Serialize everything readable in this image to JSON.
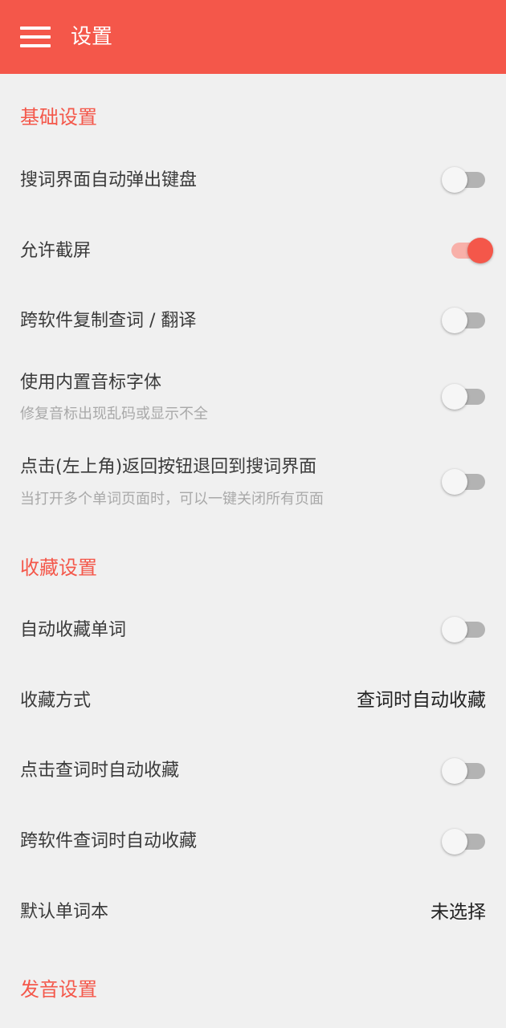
{
  "appbar": {
    "title": "设置",
    "color": "#f4574a"
  },
  "sections": {
    "basic": {
      "title": "基础设置",
      "items": [
        {
          "title": "搜词界面自动弹出键盘",
          "on": false
        },
        {
          "title": "允许截屏",
          "on": true
        },
        {
          "title": "跨软件复制查词 / 翻译",
          "on": false
        },
        {
          "title": "使用内置音标字体",
          "subtitle": "修复音标出现乱码或显示不全",
          "on": false
        },
        {
          "title": "点击(左上角)返回按钮退回到搜词界面",
          "subtitle": "当打开多个单词页面时，可以一键关闭所有页面",
          "on": false
        }
      ]
    },
    "favorites": {
      "title": "收藏设置",
      "items": [
        {
          "title": "自动收藏单词",
          "on": false
        },
        {
          "title": "收藏方式",
          "value": "查词时自动收藏"
        },
        {
          "title": "点击查词时自动收藏",
          "on": false
        },
        {
          "title": "跨软件查词时自动收藏",
          "on": false
        },
        {
          "title": "默认单词本",
          "value": "未选择"
        }
      ]
    },
    "audio": {
      "title": "发音设置"
    }
  },
  "colors": {
    "accent": "#f4574a",
    "accent_light": "#f8b0a9",
    "background": "#f0f0f0"
  }
}
